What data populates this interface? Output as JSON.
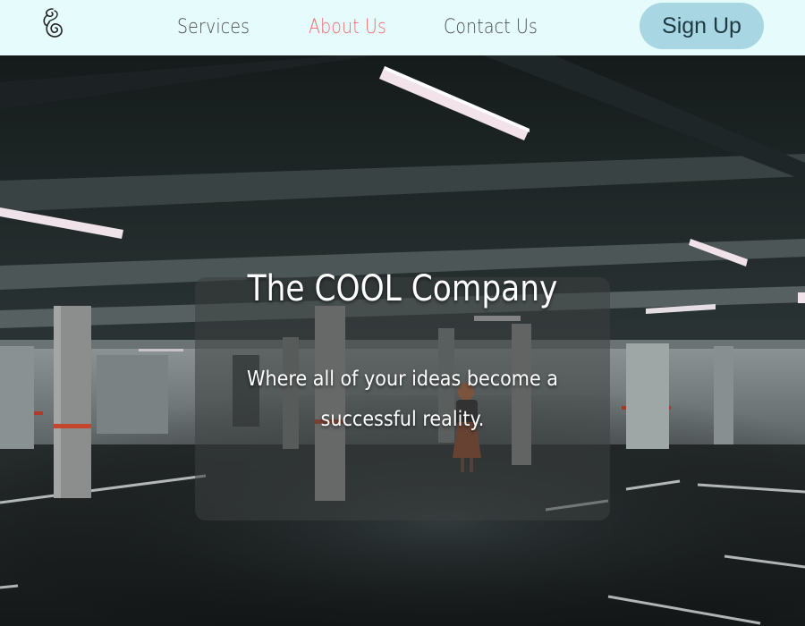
{
  "nav": {
    "links": [
      {
        "label": "Services",
        "color": "#4a4a4a"
      },
      {
        "label": "About Us",
        "color": "#ef6a6a"
      },
      {
        "label": "Contact Us",
        "color": "#4a4a4a"
      }
    ],
    "signup_label": "Sign Up",
    "logo_icon": "spiral-logo-icon",
    "background": "#e6fcfc",
    "signup_color": "#a8d7e3"
  },
  "hero": {
    "title": "The COOL Company",
    "subtitle": "Where all of your ideas become a successful reality.",
    "background_image": "dark-parking-garage-photo"
  }
}
